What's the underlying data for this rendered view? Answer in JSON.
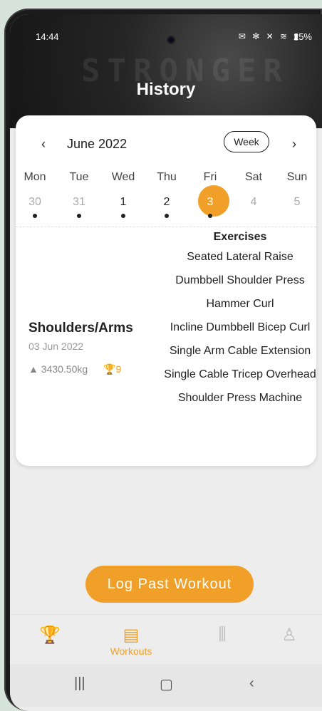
{
  "status_bar": {
    "time": "14:44",
    "battery": "25%",
    "icons": "✉ ✻ ✕ ≋ ▮"
  },
  "header": {
    "brand": "STRONGER",
    "title": "History"
  },
  "calendar": {
    "month": "June 2022",
    "view_toggle": "Week",
    "prev_icon": "‹",
    "next_icon": "›",
    "days": [
      {
        "name": "Mon",
        "date": "30"
      },
      {
        "name": "Tue",
        "date": "31"
      },
      {
        "name": "Wed",
        "date": "1"
      },
      {
        "name": "Thu",
        "date": "2"
      },
      {
        "name": "Fri",
        "date": "3"
      },
      {
        "name": "Sat",
        "date": "4"
      },
      {
        "name": "Sun",
        "date": "5"
      }
    ]
  },
  "workout": {
    "name": "Shoulders/Arms",
    "date": "03 Jun 2022",
    "volume": "3430.50kg",
    "prs": "9",
    "exercises_title": "Exercises",
    "exercises": [
      "Seated Lateral Raise",
      "Dumbbell Shoulder Press",
      "Hammer Curl",
      "Incline Dumbbell Bicep Curl",
      "Single Arm Cable Extension",
      "Single Cable Tricep Overhead",
      "Shoulder Press Machine"
    ]
  },
  "actions": {
    "log_past": "Log Past Workout"
  },
  "bottom_nav": {
    "workouts_label": "Workouts",
    "icons": {
      "trophy": "🏆",
      "workouts": "▤",
      "dumbbell": "⫼",
      "profile": "♙"
    }
  },
  "system_nav": {
    "recents": "|||",
    "home": "▢",
    "back": "‹"
  },
  "colors": {
    "accent": "#f0a028",
    "background": "#ededed",
    "card": "#ffffff"
  }
}
